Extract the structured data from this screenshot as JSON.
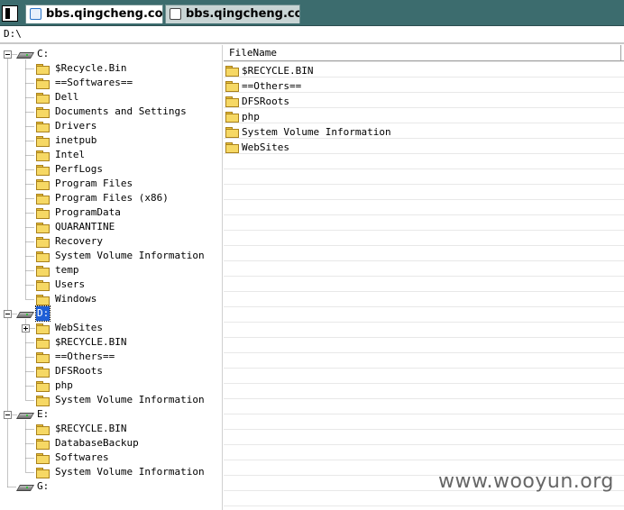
{
  "tabs": [
    {
      "label": "bbs.qingcheng.co:",
      "active": true
    },
    {
      "label": "bbs.qingcheng.co:",
      "active": false
    }
  ],
  "address": {
    "path": "D:\\"
  },
  "tree": {
    "drives": [
      {
        "label": "C:",
        "expanded": true,
        "selected": false,
        "children": [
          "$Recycle.Bin",
          "==Softwares==",
          "Dell",
          "Documents and Settings",
          "Drivers",
          "inetpub",
          "Intel",
          "PerfLogs",
          "Program Files",
          "Program Files (x86)",
          "ProgramData",
          "QUARANTINE",
          "Recovery",
          "System Volume Information",
          "temp",
          "Users",
          "Windows"
        ]
      },
      {
        "label": "D:",
        "expanded": true,
        "selected": true,
        "children": [
          "WebSites",
          "$RECYCLE.BIN",
          "==Others==",
          "DFSRoots",
          "php",
          "System Volume Information"
        ],
        "collapsible_children": [
          "WebSites"
        ]
      },
      {
        "label": "E:",
        "expanded": true,
        "selected": false,
        "children": [
          "$RECYCLE.BIN",
          "DatabaseBackup",
          "Softwares",
          "System Volume Information"
        ]
      },
      {
        "label": "G:",
        "expanded": false,
        "selected": false,
        "children": []
      }
    ]
  },
  "file_list": {
    "column_header": "FileName",
    "items": [
      "$RECYCLE.BIN",
      "==Others==",
      "DFSRoots",
      "php",
      "System Volume Information",
      "WebSites"
    ]
  },
  "watermark": "www.wooyun.org",
  "colors": {
    "tabbar_bg": "#3c6c6e",
    "selection_bg": "#1f5fd6",
    "folder_yellow": "#f6d864"
  },
  "icons": {
    "drive": "drive-icon",
    "folder": "folder-icon",
    "expander_minus": "collapse-icon",
    "expander_plus": "expand-icon"
  }
}
